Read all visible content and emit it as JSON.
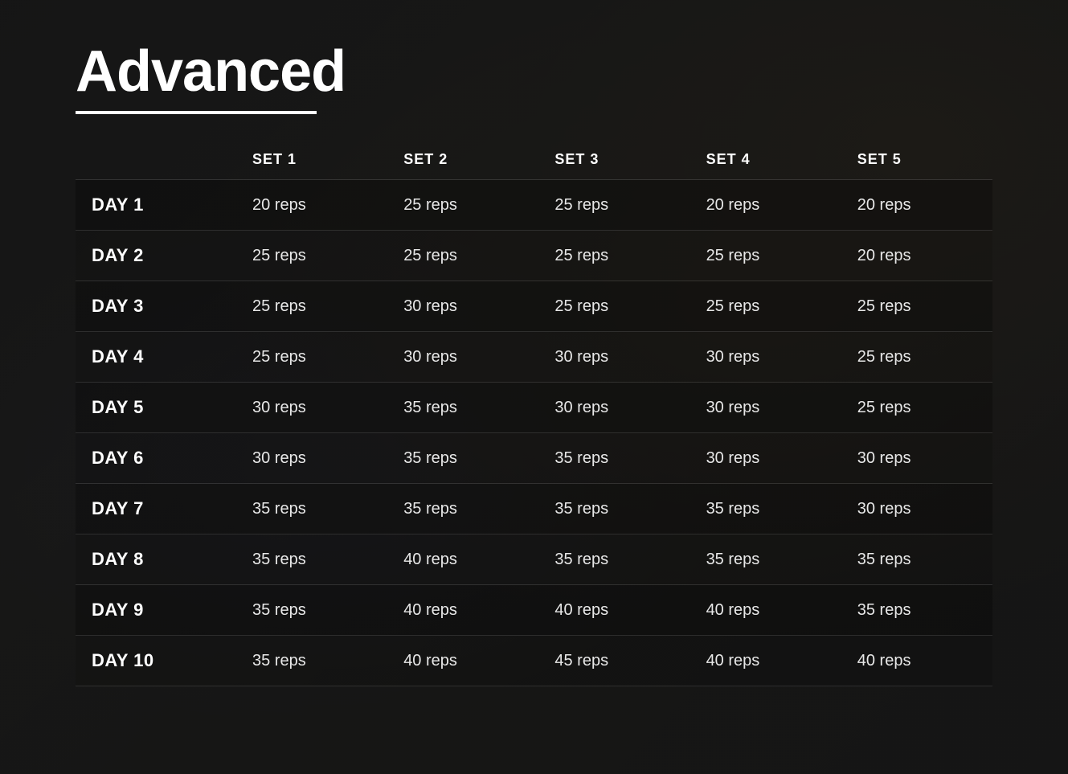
{
  "page": {
    "title": "Advanced",
    "background_color": "#1a1a1a"
  },
  "table": {
    "headers": [
      "",
      "SET 1",
      "SET 2",
      "SET 3",
      "SET 4",
      "SET 5"
    ],
    "rows": [
      {
        "day": "DAY 1",
        "set1": "20 reps",
        "set2": "25 reps",
        "set3": "25 reps",
        "set4": "20 reps",
        "set5": "20 reps"
      },
      {
        "day": "DAY 2",
        "set1": "25 reps",
        "set2": "25 reps",
        "set3": "25 reps",
        "set4": "25 reps",
        "set5": "20 reps"
      },
      {
        "day": "DAY 3",
        "set1": "25 reps",
        "set2": "30 reps",
        "set3": "25 reps",
        "set4": "25 reps",
        "set5": "25 reps"
      },
      {
        "day": "DAY 4",
        "set1": "25 reps",
        "set2": "30 reps",
        "set3": "30 reps",
        "set4": "30 reps",
        "set5": "25 reps"
      },
      {
        "day": "DAY 5",
        "set1": "30 reps",
        "set2": "35 reps",
        "set3": "30 reps",
        "set4": "30 reps",
        "set5": "25 reps"
      },
      {
        "day": "DAY 6",
        "set1": "30 reps",
        "set2": "35 reps",
        "set3": "35 reps",
        "set4": "30 reps",
        "set5": "30 reps"
      },
      {
        "day": "DAY 7",
        "set1": "35 reps",
        "set2": "35 reps",
        "set3": "35 reps",
        "set4": "35 reps",
        "set5": "30 reps"
      },
      {
        "day": "DAY 8",
        "set1": "35 reps",
        "set2": "40 reps",
        "set3": "35 reps",
        "set4": "35 reps",
        "set5": "35 reps"
      },
      {
        "day": "DAY 9",
        "set1": "35 reps",
        "set2": "40 reps",
        "set3": "40 reps",
        "set4": "40 reps",
        "set5": "35 reps"
      },
      {
        "day": "DAY 10",
        "set1": "35 reps",
        "set2": "40 reps",
        "set3": "45 reps",
        "set4": "40 reps",
        "set5": "40 reps"
      }
    ]
  }
}
